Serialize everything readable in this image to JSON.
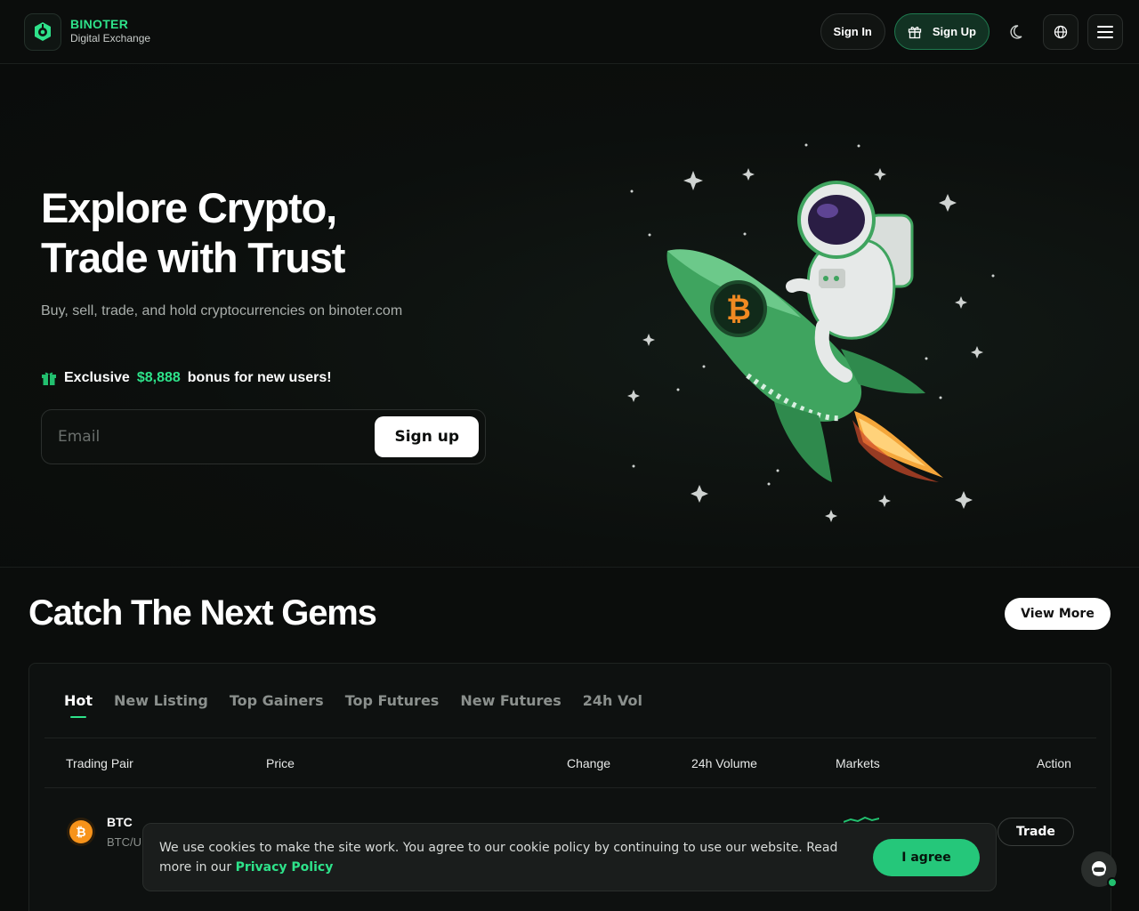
{
  "brand": {
    "name": "BINOTER",
    "tagline": "Digital Exchange"
  },
  "nav": {
    "sign_in": "Sign In",
    "sign_up": "Sign Up"
  },
  "hero": {
    "title_line1": "Explore Crypto,",
    "title_line2": "Trade with Trust",
    "subtitle": "Buy, sell, trade, and hold cryptocurrencies on binoter.com",
    "bonus_prefix": "Exclusive",
    "bonus_amount": "$8,888",
    "bonus_suffix": "bonus for new users!",
    "email_placeholder": "Email",
    "signup_button": "Sign up"
  },
  "gems": {
    "title": "Catch The Next Gems",
    "view_more": "View More",
    "tabs": [
      "Hot",
      "New Listing",
      "Top Gainers",
      "Top Futures",
      "New Futures",
      "24h Vol"
    ],
    "columns": [
      "Trading Pair",
      "Price",
      "Change",
      "24h Volume",
      "Markets",
      "Action"
    ],
    "rows": [
      {
        "symbol": "BTC",
        "pair": "BTC/U",
        "action": "Trade"
      }
    ]
  },
  "cookie": {
    "text": "We use cookies to make the site work. You agree to our cookie policy by continuing to use our website. Read more in our",
    "link": "Privacy Policy",
    "agree": "I agree"
  },
  "colors": {
    "accent": "#2ee28a",
    "background": "#0b0d0c",
    "btc": "#f7931a"
  }
}
